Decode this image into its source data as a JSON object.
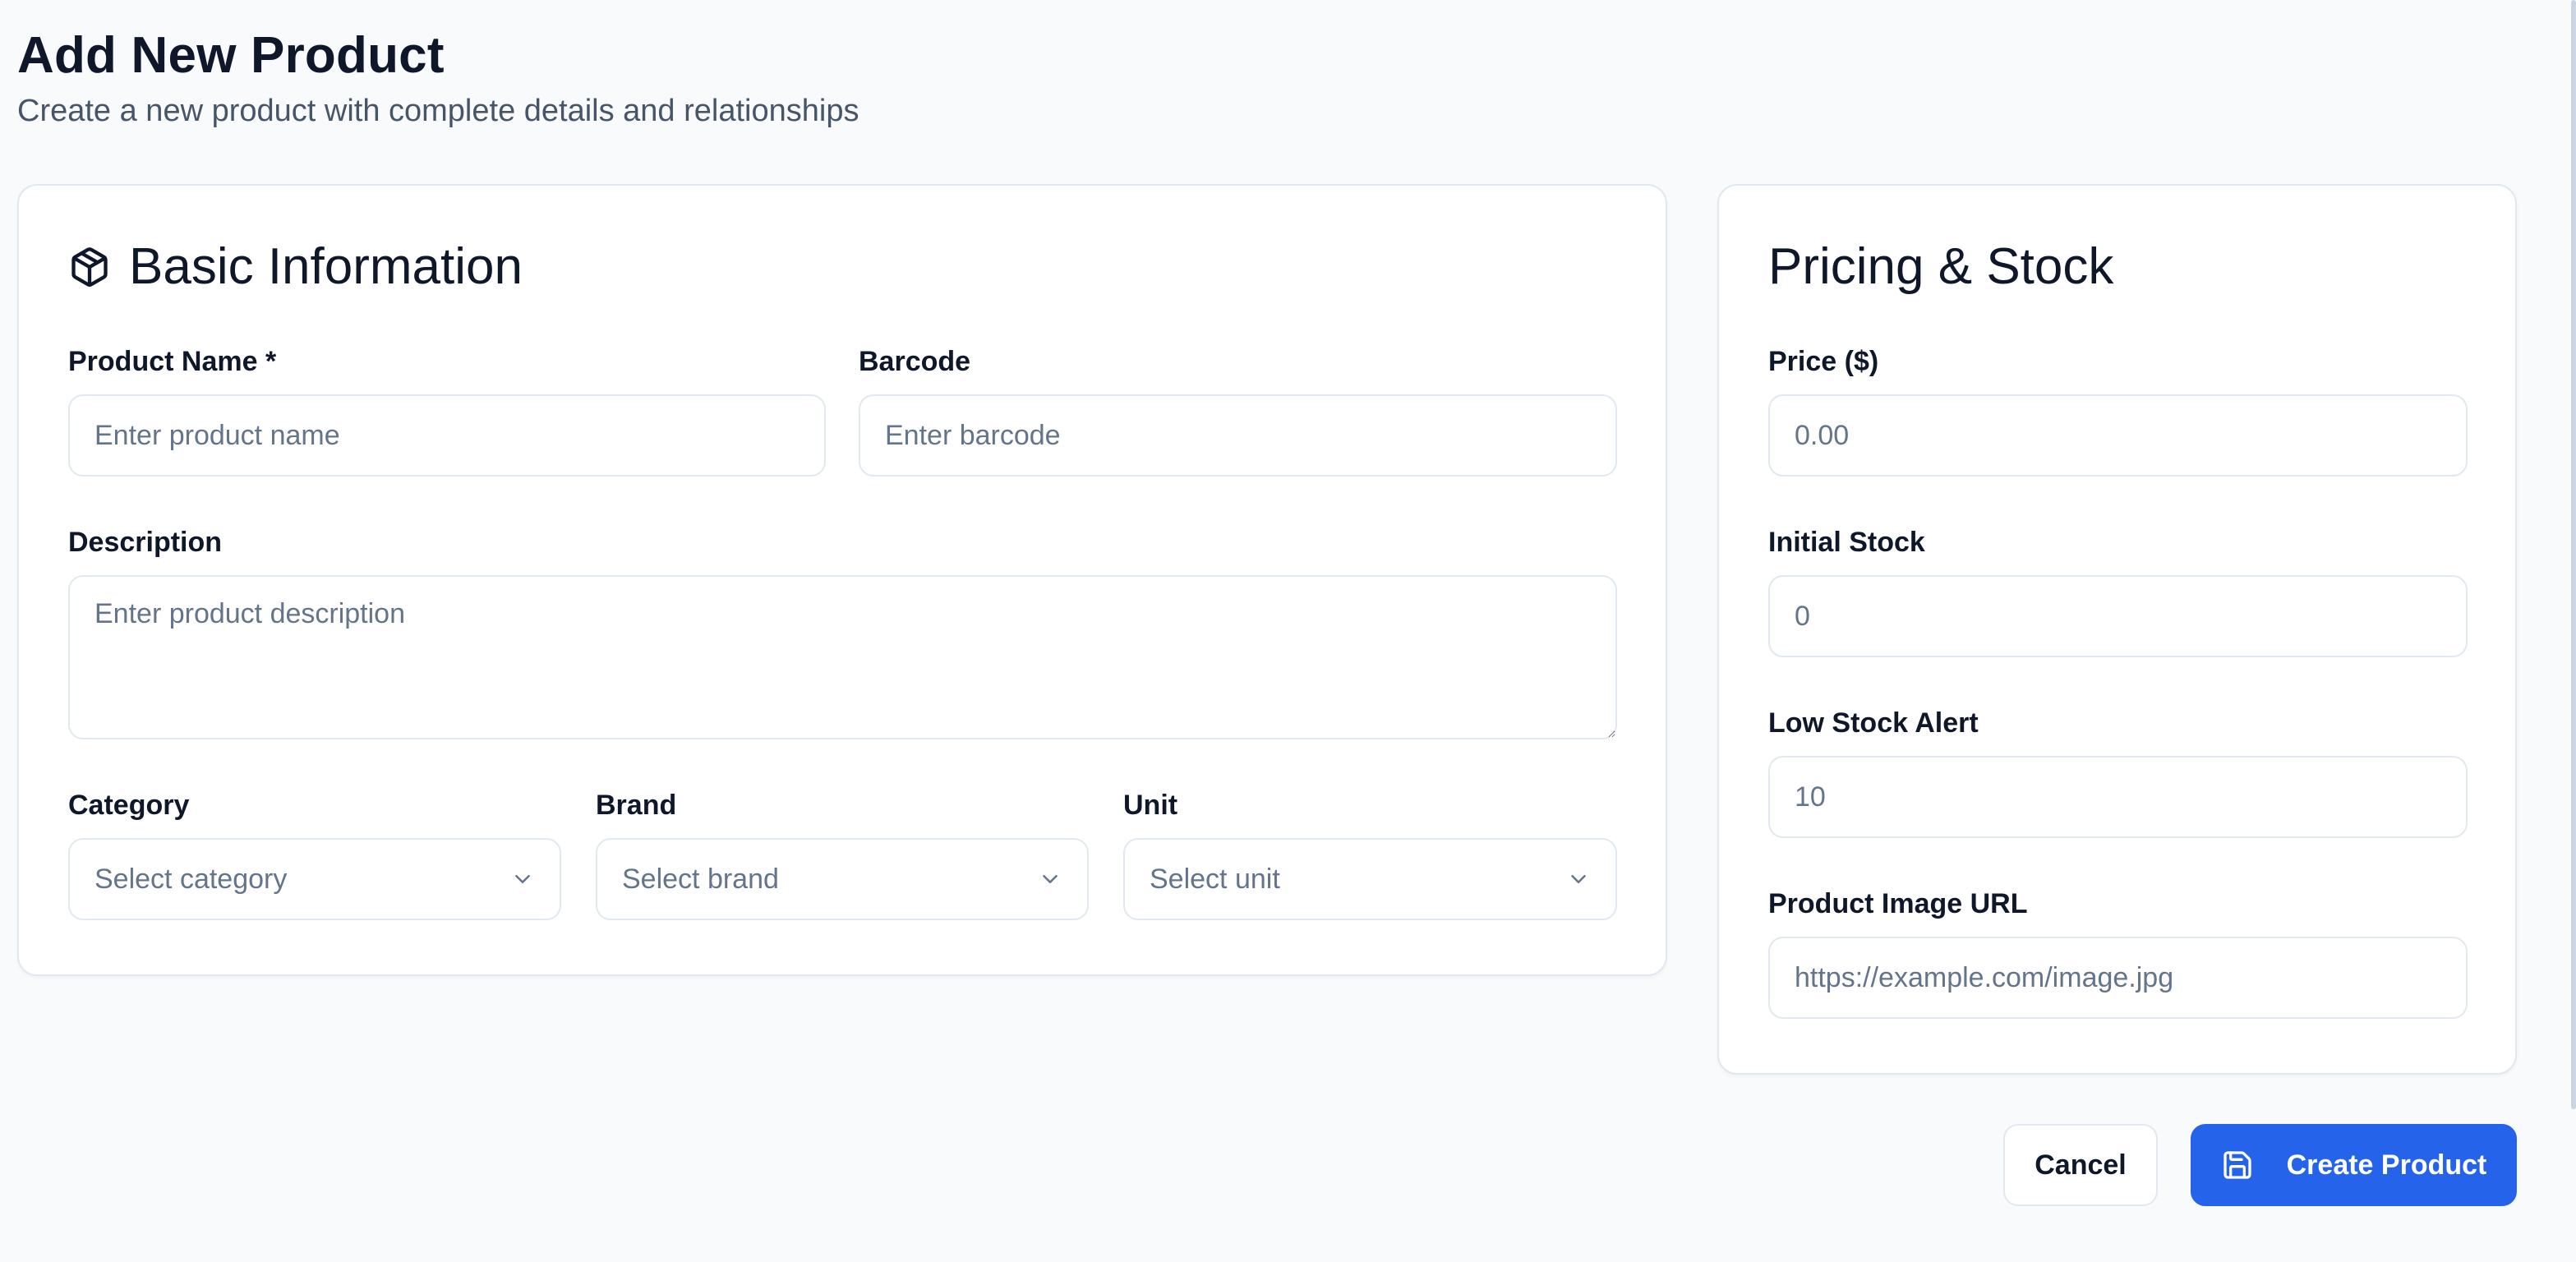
{
  "page": {
    "title": "Add New Product",
    "subtitle": "Create a new product with complete details and relationships"
  },
  "basic_info": {
    "title": "Basic Information",
    "icon": "package-icon",
    "product_name": {
      "label": "Product Name *",
      "placeholder": "Enter product name",
      "value": ""
    },
    "barcode": {
      "label": "Barcode",
      "placeholder": "Enter barcode",
      "value": ""
    },
    "description": {
      "label": "Description",
      "placeholder": "Enter product description",
      "value": ""
    },
    "category": {
      "label": "Category",
      "selected": "Select category"
    },
    "brand": {
      "label": "Brand",
      "selected": "Select brand"
    },
    "unit": {
      "label": "Unit",
      "selected": "Select unit"
    }
  },
  "pricing": {
    "title": "Pricing & Stock",
    "price": {
      "label": "Price ($)",
      "placeholder": "0.00",
      "value": ""
    },
    "initial_stock": {
      "label": "Initial Stock",
      "placeholder": "0",
      "value": ""
    },
    "low_stock_alert": {
      "label": "Low Stock Alert",
      "placeholder": "10",
      "value": ""
    },
    "image_url": {
      "label": "Product Image URL",
      "placeholder": "https://example.com/image.jpg",
      "value": ""
    }
  },
  "actions": {
    "cancel_label": "Cancel",
    "create_label": "Create Product",
    "create_icon": "save-icon"
  },
  "colors": {
    "primary": "#2563eb",
    "background": "#f8fafc",
    "border": "#e2e8f0",
    "text": "#0f172a",
    "muted_text": "#64748b"
  }
}
